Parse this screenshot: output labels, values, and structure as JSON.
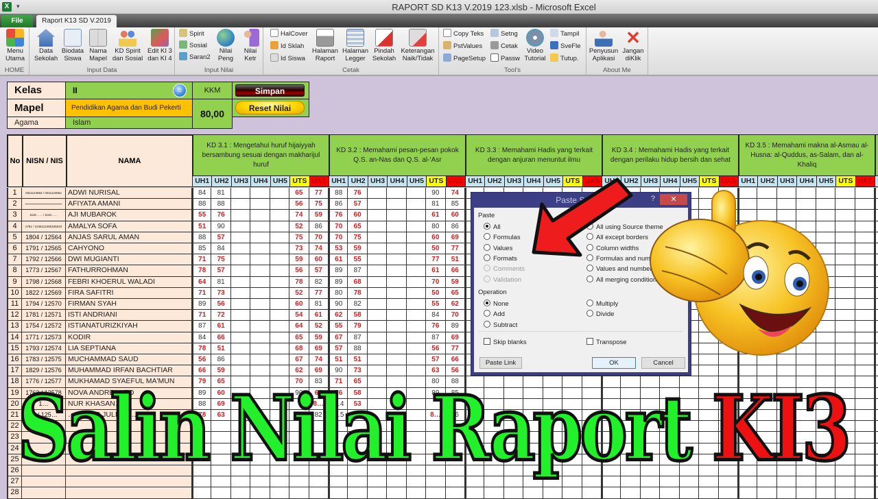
{
  "window": {
    "title": "RAPORT SD K13 V.2019 123.xlsb  -  Microsoft Excel",
    "app_icon": "excel-icon",
    "qat_symbol": "▾"
  },
  "tabs": [
    {
      "label": "File",
      "active": false
    },
    {
      "label": "Raport K13 SD V.2019",
      "active": true
    }
  ],
  "ribbon": {
    "groups": [
      {
        "label": "HOME",
        "buttons": [
          {
            "label1": "Menu",
            "label2": "Utama",
            "icon": "menu-grid-icon"
          }
        ]
      },
      {
        "label": "Input Data",
        "buttons": [
          {
            "label1": "Data",
            "label2": "Sekolah",
            "icon": "house-icon"
          },
          {
            "label1": "Biodata",
            "label2": "Siswa",
            "icon": "id-card-icon"
          },
          {
            "label1": "Nama",
            "label2": "Mapel",
            "icon": "book-icon"
          },
          {
            "label1": "KD Spirit",
            "label2": "dan Sosial",
            "icon": "group-people-icon"
          },
          {
            "label1": "Edit KI 3",
            "label2": "dan KI 4",
            "icon": "edit-cards-icon"
          }
        ]
      },
      {
        "label": "Input Nilai",
        "small": [
          {
            "label": "Spirit",
            "icon": "spirit-icon"
          },
          {
            "label": "Sosial",
            "icon": "sosial-icon"
          },
          {
            "label": "Saran2",
            "icon": "saran-icon"
          }
        ],
        "buttons": [
          {
            "label1": "Nilai",
            "label2": "Peng",
            "icon": "globe-user-icon"
          },
          {
            "label1": "Nilai",
            "label2": "Ketr",
            "icon": "user-arrow-icon"
          }
        ]
      },
      {
        "label": "Cetak",
        "small": [
          {
            "label": "HalCover",
            "icon": "page-icon"
          },
          {
            "label": "Id Sklah",
            "icon": "home-small-icon"
          },
          {
            "label": "Id Siswa",
            "icon": "user-small-icon"
          }
        ],
        "buttons": [
          {
            "label1": "Halaman",
            "label2": "Raport",
            "icon": "printer-icon"
          },
          {
            "label1": "Halaman",
            "label2": "Legger",
            "icon": "table-icon"
          },
          {
            "label1": "Pindah",
            "label2": "Sekolah",
            "icon": "document-x-icon"
          },
          {
            "label1": "Keterangan",
            "label2": "Naik/Tidak",
            "icon": "table-x-icon"
          }
        ]
      },
      {
        "label": "Tool's",
        "small": [
          {
            "label": "Copy Teks",
            "icon": "copy-icon"
          },
          {
            "label": "PstValues",
            "icon": "paste-values-icon"
          },
          {
            "label": "PageSetup",
            "icon": "page-setup-icon"
          },
          {
            "label": "Setng",
            "icon": "settings-icon"
          },
          {
            "label": "Cetak",
            "icon": "print-small-icon"
          },
          {
            "label": "Passw",
            "icon": "password-icon"
          },
          {
            "label": "Tampil",
            "icon": "preview-icon"
          },
          {
            "label": "SveFle",
            "icon": "save-icon"
          },
          {
            "label": "Tutup.",
            "icon": "folder-icon"
          }
        ],
        "buttons": [
          {
            "label1": "Video",
            "label2": "Tutorial",
            "icon": "film-reel-icon"
          }
        ]
      },
      {
        "label": "About Me",
        "buttons": [
          {
            "label1": "Penyusun",
            "label2": "Aplikasi",
            "icon": "user-minus-icon"
          },
          {
            "label1": "Jangan",
            "label2": "diKlik",
            "icon": "red-x-icon"
          }
        ]
      }
    ]
  },
  "info": {
    "kelas_label": "Kelas",
    "kelas_value": "II",
    "mapel_label": "Mapel",
    "mapel_value": "Pendidikan Agama dan Budi Pekerti",
    "agama_label": "Agama",
    "agama_value": "Islam",
    "kkm_label": "KKM",
    "kkm_value": "80,00",
    "simpan_label": "Simpan",
    "reset_label": "Reset Nilai",
    "home_symbol": "⌂"
  },
  "table": {
    "headers": {
      "no": "No",
      "nisn": "NISN / NIS",
      "nama": "NAMA"
    },
    "kd": [
      "KD 3.1 : Mengetahui huruf hijaiyyah bersambung sesuai dengan makharijul huruf",
      "KD 3.2 : Memahami pesan-pesan pokok Q.S. an-Nas dan Q.S. al-‘Asr",
      "KD 3.3 : Memahami Hadis yang terkait dengan anjuran menuntut ilmu",
      "KD 3.4 : Memahami Hadis yang terkait dengan perilaku hidup bersih dan sehat",
      "KD 3.5 : Memahami makna al-Asmau al-Husna: al-Quddus, as-Salam, dan al-Khaliq"
    ],
    "subcols": [
      "UH1",
      "UH2",
      "UH3",
      "UH4",
      "UH5",
      "UTS",
      "UAS"
    ],
    "kkm_threshold": 80,
    "rows": [
      {
        "no": "1",
        "nisn": "0311124564 / 0311124564",
        "nama": "ADWI NURISAL",
        "kd1": [
          "84",
          "81",
          "",
          "",
          "",
          "65",
          "77"
        ],
        "kd2": [
          "88",
          "76",
          "",
          "",
          "",
          "90",
          "74"
        ]
      },
      {
        "no": "2",
        "nisn": "——————",
        "nama": "AFIYATA AMANI",
        "kd1": [
          "88",
          "88",
          "",
          "",
          "",
          "56",
          "75"
        ],
        "kd2": [
          "86",
          "57",
          "",
          "",
          "",
          "81",
          "85"
        ]
      },
      {
        "no": "3",
        "nisn": "1118…… / 1118……",
        "nama": "AJI MUBAROK",
        "kd1": [
          "55",
          "76",
          "",
          "",
          "",
          "74",
          "59"
        ],
        "kd2": [
          "76",
          "60",
          "",
          "",
          "",
          "61",
          "60"
        ]
      },
      {
        "no": "4",
        "nisn": "1791 / 1045112450345010",
        "nama": "AMALYA SOFA",
        "kd1": [
          "51",
          "90",
          "",
          "",
          "",
          "52",
          "86"
        ],
        "kd2": [
          "70",
          "65",
          "",
          "",
          "",
          "80",
          "86"
        ]
      },
      {
        "no": "5",
        "nisn": "1804 / 12564",
        "nama": "ANJAS SARUL AMAN",
        "kd1": [
          "88",
          "57",
          "",
          "",
          "",
          "75",
          "70"
        ],
        "kd2": [
          "70",
          "75",
          "",
          "",
          "",
          "60",
          "69"
        ]
      },
      {
        "no": "6",
        "nisn": "1791 / 12565",
        "nama": "CAHYONO",
        "kd1": [
          "85",
          "84",
          "",
          "",
          "",
          "73",
          "74"
        ],
        "kd2": [
          "53",
          "59",
          "",
          "",
          "",
          "50",
          "77"
        ]
      },
      {
        "no": "7",
        "nisn": "1792 / 12566",
        "nama": "DWI MUGIANTI",
        "kd1": [
          "71",
          "75",
          "",
          "",
          "",
          "59",
          "60"
        ],
        "kd2": [
          "61",
          "55",
          "",
          "",
          "",
          "77",
          "51"
        ]
      },
      {
        "no": "8",
        "nisn": "1773 / 12567",
        "nama": "FATHURROHMAN",
        "kd1": [
          "78",
          "57",
          "",
          "",
          "",
          "56",
          "57"
        ],
        "kd2": [
          "89",
          "87",
          "",
          "",
          "",
          "61",
          "66"
        ]
      },
      {
        "no": "9",
        "nisn": "1798 / 12568",
        "nama": "FEBRI KHOERUL WALADI",
        "kd1": [
          "64",
          "81",
          "",
          "",
          "",
          "78",
          "82"
        ],
        "kd2": [
          "89",
          "68",
          "",
          "",
          "",
          "70",
          "59"
        ]
      },
      {
        "no": "10",
        "nisn": "1822 / 12569",
        "nama": "FIRA SAFITRI",
        "kd1": [
          "71",
          "73",
          "",
          "",
          "",
          "52",
          "77"
        ],
        "kd2": [
          "80",
          "78",
          "",
          "",
          "",
          "50",
          "65"
        ]
      },
      {
        "no": "11",
        "nisn": "1794 / 12570",
        "nama": "FIRMAN SYAH",
        "kd1": [
          "89",
          "56",
          "",
          "",
          "",
          "60",
          "81"
        ],
        "kd2": [
          "90",
          "82",
          "",
          "",
          "",
          "55",
          "62"
        ]
      },
      {
        "no": "12",
        "nisn": "1781 / 12571",
        "nama": "ISTI ANDRIANI",
        "kd1": [
          "71",
          "72",
          "",
          "",
          "",
          "54",
          "61"
        ],
        "kd2": [
          "62",
          "58",
          "",
          "",
          "",
          "84",
          "70"
        ]
      },
      {
        "no": "13",
        "nisn": "1754 / 12572",
        "nama": "ISTIANATURIZKIYAH",
        "kd1": [
          "87",
          "61",
          "",
          "",
          "",
          "64",
          "52"
        ],
        "kd2": [
          "55",
          "79",
          "",
          "",
          "",
          "76",
          "89"
        ]
      },
      {
        "no": "14",
        "nisn": "1771 / 12573",
        "nama": "KODIR",
        "kd1": [
          "84",
          "66",
          "",
          "",
          "",
          "65",
          "59"
        ],
        "kd2": [
          "67",
          "87",
          "",
          "",
          "",
          "87",
          "69"
        ]
      },
      {
        "no": "15",
        "nisn": "1793 / 12574",
        "nama": "LIA SEPTIANA",
        "kd1": [
          "78",
          "51",
          "",
          "",
          "",
          "68",
          "69"
        ],
        "kd2": [
          "57",
          "88",
          "",
          "",
          "",
          "56",
          "77"
        ]
      },
      {
        "no": "16",
        "nisn": "1783 / 12575",
        "nama": "MUCHAMMAD SAUD",
        "kd1": [
          "56",
          "86",
          "",
          "",
          "",
          "67",
          "74"
        ],
        "kd2": [
          "51",
          "51",
          "",
          "",
          "",
          "57",
          "66"
        ]
      },
      {
        "no": "17",
        "nisn": "1829 / 12576",
        "nama": "MUHAMMAD IRFAN BACHTIAR",
        "kd1": [
          "66",
          "59",
          "",
          "",
          "",
          "62",
          "69"
        ],
        "kd2": [
          "90",
          "73",
          "",
          "",
          "",
          "63",
          "56"
        ]
      },
      {
        "no": "18",
        "nisn": "1776 / 12577",
        "nama": "MUKHAMAD SYAEFUL MA'MUN",
        "kd1": [
          "79",
          "65",
          "",
          "",
          "",
          "70",
          "83"
        ],
        "kd2": [
          "71",
          "65",
          "",
          "",
          "",
          "80",
          "88"
        ]
      },
      {
        "no": "19",
        "nisn": "1763 / 12578",
        "nama": "NOVA ANDREANTO",
        "kd1": [
          "89",
          "60",
          "",
          "",
          "",
          "90",
          "64"
        ],
        "kd2": [
          "76",
          "58",
          "",
          "",
          "",
          "89",
          "85"
        ]
      },
      {
        "no": "20",
        "nisn": "1…",
        "nama": "NUR KHASAN…",
        "kd1": [
          "88",
          "69",
          "",
          "",
          "",
          "",
          "8…"
        ],
        "kd2": [
          "…4",
          "53",
          "",
          "",
          "",
          "",
          ""
        ]
      },
      {
        "no": "21",
        "nisn": "… / 125…",
        "nama": "…OSKAR JULIANT…",
        "kd1": [
          "78",
          "63",
          "",
          "",
          "",
          "7…",
          "82"
        ],
        "kd2": [
          "…5",
          "81",
          "",
          "",
          "",
          "8…",
          "86"
        ]
      },
      {
        "no": "22",
        "nisn": "",
        "nama": "",
        "kd1": [],
        "kd2": []
      },
      {
        "no": "23",
        "nisn": "",
        "nama": "",
        "kd1": [],
        "kd2": []
      },
      {
        "no": "24",
        "nisn": "",
        "nama": "",
        "kd1": [],
        "kd2": []
      },
      {
        "no": "25",
        "nisn": "",
        "nama": "",
        "kd1": [],
        "kd2": []
      },
      {
        "no": "26",
        "nisn": "",
        "nama": "",
        "kd1": [],
        "kd2": []
      },
      {
        "no": "27",
        "nisn": "",
        "nama": "",
        "kd1": [],
        "kd2": []
      },
      {
        "no": "28",
        "nisn": "",
        "nama": "",
        "kd1": [],
        "kd2": []
      }
    ]
  },
  "dialog": {
    "title": "Paste Special",
    "help": "?",
    "close": "✕",
    "paste_section": "Paste",
    "paste_left": [
      {
        "label": "All",
        "checked": true,
        "disabled": false
      },
      {
        "label": "Formulas",
        "checked": false,
        "disabled": false
      },
      {
        "label": "Values",
        "checked": false,
        "disabled": false
      },
      {
        "label": "Formats",
        "checked": false,
        "disabled": false
      },
      {
        "label": "Comments",
        "checked": false,
        "disabled": true
      },
      {
        "label": "Validation",
        "checked": false,
        "disabled": true
      }
    ],
    "paste_right": [
      {
        "label": "All using Source theme",
        "checked": false
      },
      {
        "label": "All except borders",
        "checked": false
      },
      {
        "label": "Column widths",
        "checked": false
      },
      {
        "label": "Formulas and number formats",
        "checked": false
      },
      {
        "label": "Values and number formats",
        "checked": false
      },
      {
        "label": "All merging conditional formats",
        "checked": false
      }
    ],
    "operation_section": "Operation",
    "op_left": [
      {
        "label": "None",
        "checked": true
      },
      {
        "label": "Add",
        "checked": false
      },
      {
        "label": "Subtract",
        "checked": false
      }
    ],
    "op_right": [
      {
        "label": "Multiply",
        "checked": false
      },
      {
        "label": "Divide",
        "checked": false
      }
    ],
    "skip_blanks": "Skip blanks",
    "transpose": "Transpose",
    "paste_link": "Paste Link",
    "ok": "OK",
    "cancel": "Cancel"
  },
  "overlay": {
    "banner_green": "Salin Nilai Raport ",
    "banner_red": "KI3",
    "arrow": "red-arrow",
    "emoji": "thumbs-up-smiley"
  },
  "colors": {
    "header_green": "#92d050",
    "label_peach": "#fde9d9",
    "sub_blue": "#c5e5f2",
    "uts_yellow": "#ffff00",
    "uas_red": "#ff0000",
    "low_score_red": "#d02020",
    "sheet_bg": "#cfc3dc"
  }
}
